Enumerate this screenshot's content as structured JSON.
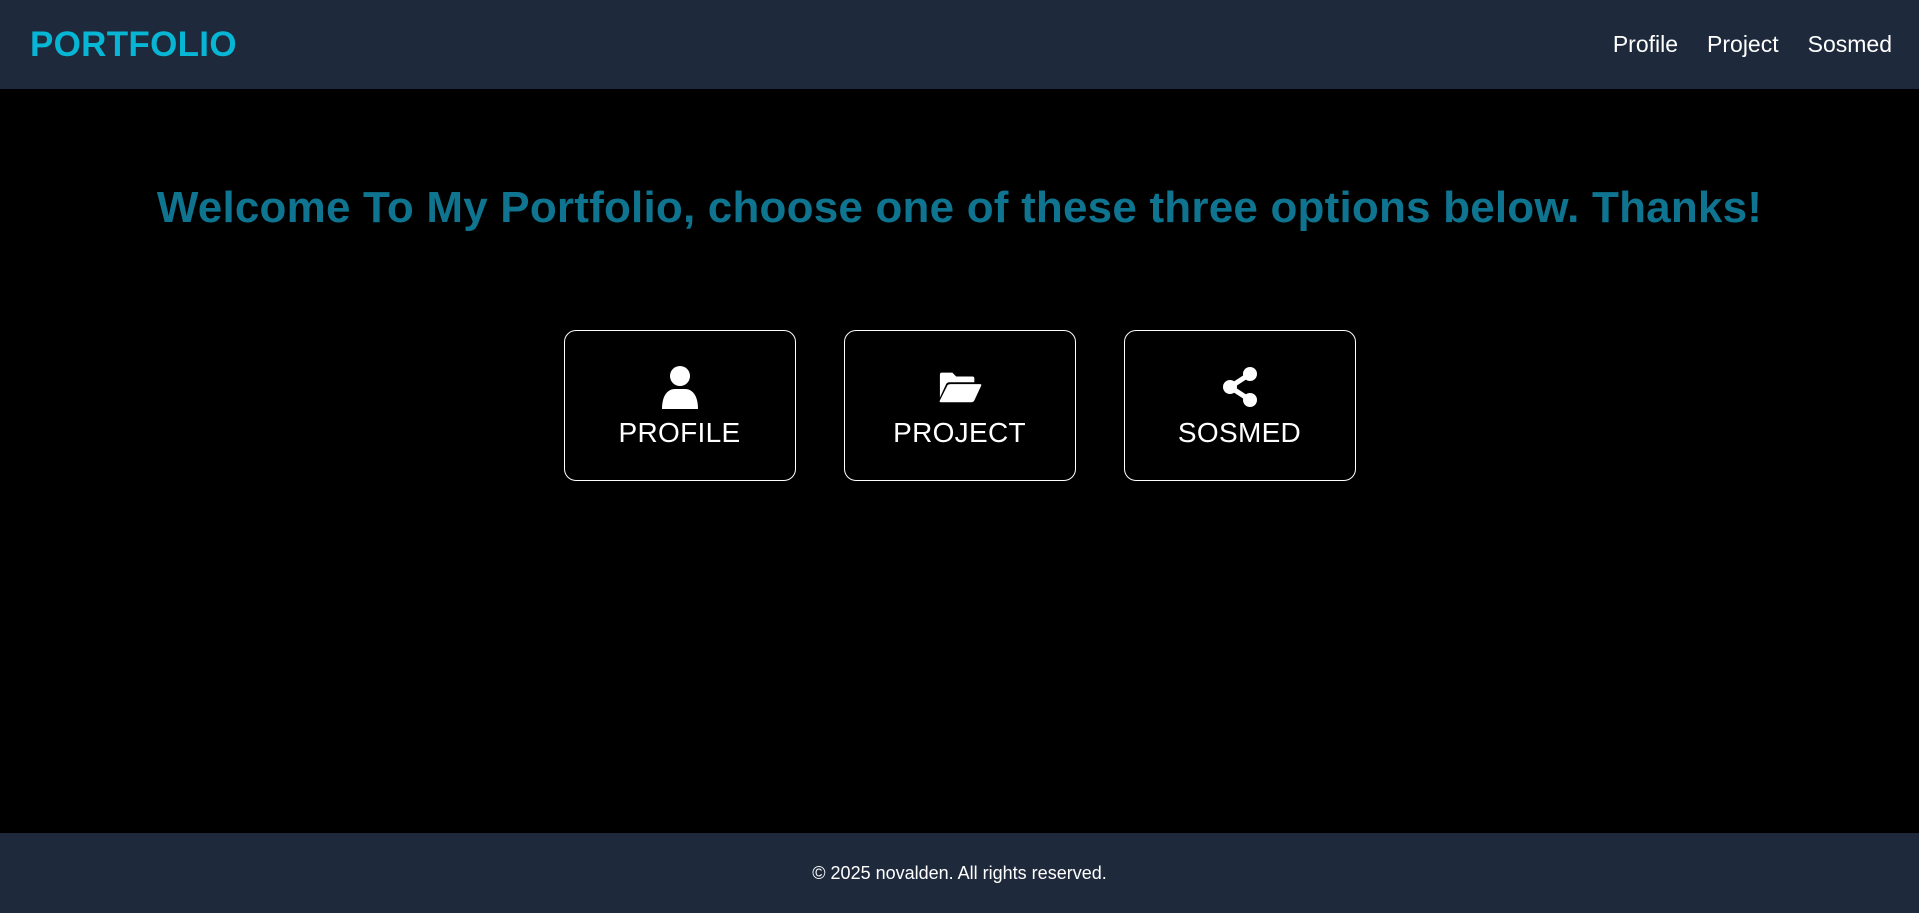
{
  "header": {
    "brand": "PORTFOLIO",
    "nav": [
      {
        "label": "Profile"
      },
      {
        "label": "Project"
      },
      {
        "label": "Sosmed"
      }
    ]
  },
  "main": {
    "welcome": "Welcome To My Portfolio, choose one of these three options below. Thanks!",
    "cards": [
      {
        "label": "PROFILE",
        "icon": "user-icon"
      },
      {
        "label": "PROJECT",
        "icon": "folder-open-icon"
      },
      {
        "label": "SOSMED",
        "icon": "share-icon"
      }
    ]
  },
  "footer": {
    "text": "© 2025 novalden. All rights reserved."
  },
  "colors": {
    "header_bg": "#1e293b",
    "brand": "#06b6d4",
    "welcome": "#0e7490",
    "body_bg": "#000000",
    "text": "#ffffff"
  }
}
